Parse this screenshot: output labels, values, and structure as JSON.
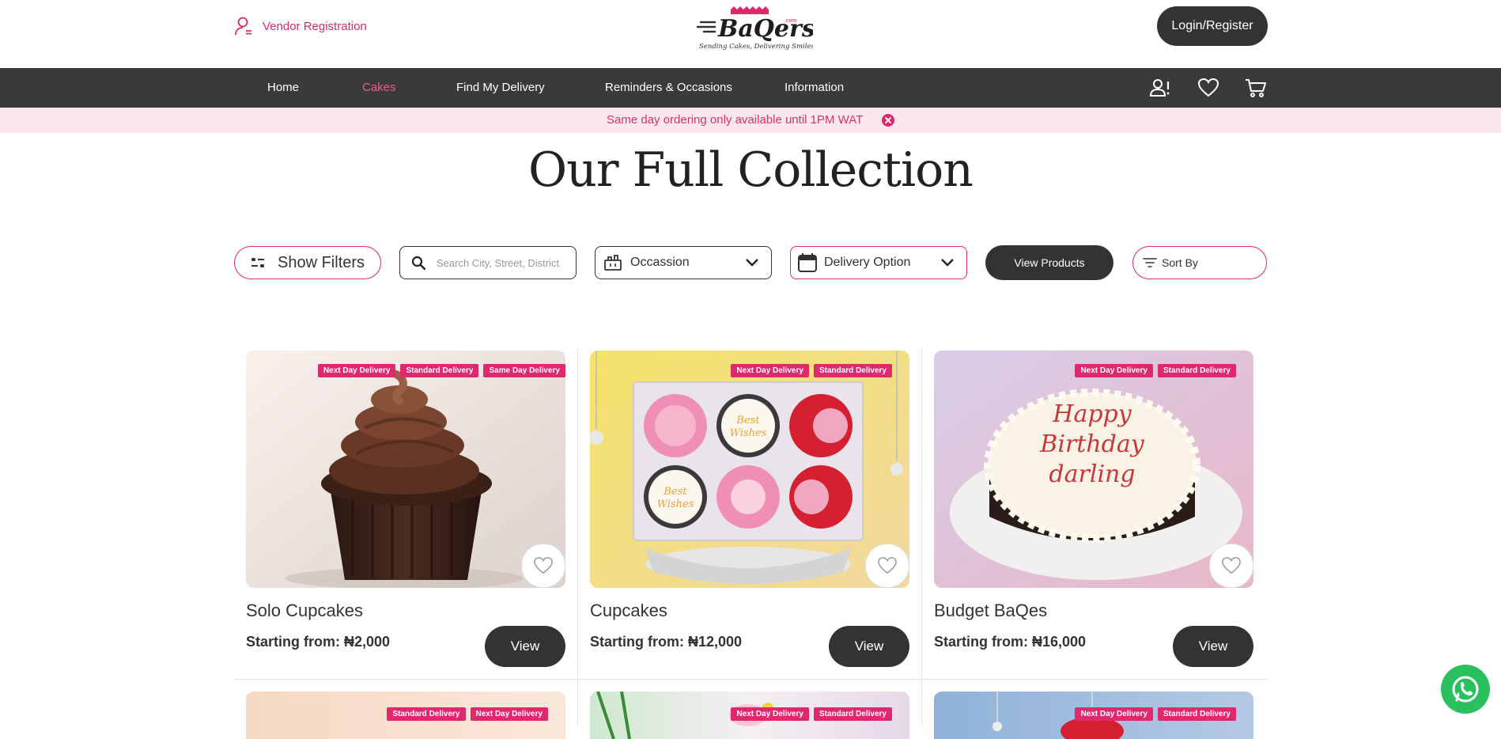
{
  "header": {
    "vendor_label": "Vendor Registration",
    "login_label": "Login/Register",
    "logo_text": "BaQers",
    "logo_tagline": "Sending Cakes, Delivering Smiles",
    "logo_suffix": ".com"
  },
  "nav": {
    "items": [
      {
        "label": "Home",
        "active": false
      },
      {
        "label": "Cakes",
        "active": true
      },
      {
        "label": "Find My Delivery",
        "active": false
      },
      {
        "label": "Reminders & Occasions",
        "active": false
      },
      {
        "label": "Information",
        "active": false
      }
    ],
    "icons": [
      "account-alert-icon",
      "heart-icon",
      "cart-icon"
    ]
  },
  "notice": {
    "text": "Same day ordering only available until 1PM WAT"
  },
  "page": {
    "title": "Our Full Collection"
  },
  "filters": {
    "show_filters_label": "Show Filters",
    "search_placeholder": "Search City, Street, District",
    "occasion_label": "Occassion",
    "delivery_label": "Delivery Option",
    "view_products_label": "View Products",
    "sort_label": "Sort By"
  },
  "products": [
    {
      "name": "Solo Cupcakes",
      "price": "Starting from: ₦2,000",
      "badges": [
        "Next Day Delivery",
        "Standard Delivery",
        "Same Day Delivery"
      ],
      "view_label": "View"
    },
    {
      "name": "Cupcakes",
      "price": "Starting from: ₦12,000",
      "badges": [
        "Next Day Delivery",
        "Standard Delivery"
      ],
      "view_label": "View"
    },
    {
      "name": "Budget BaQes",
      "price": "Starting from: ₦16,000",
      "badges": [
        "Next Day Delivery",
        "Standard Delivery"
      ],
      "view_label": "View",
      "cake_text": [
        "Happy",
        "Birthday",
        "darling"
      ]
    }
  ],
  "products_row2": [
    {
      "badges": [
        "Standard Delivery",
        "Next Day Delivery"
      ]
    },
    {
      "badges": [
        "Next Day Delivery",
        "Standard Delivery"
      ]
    },
    {
      "badges": [
        "Next Day Delivery",
        "Standard Delivery"
      ]
    }
  ],
  "colors": {
    "brand_pink": "#e0286e",
    "dark": "#333333",
    "nav_bg": "#3a3a3a",
    "notice_bg": "#fde7ef",
    "whatsapp": "#2ac05e"
  }
}
